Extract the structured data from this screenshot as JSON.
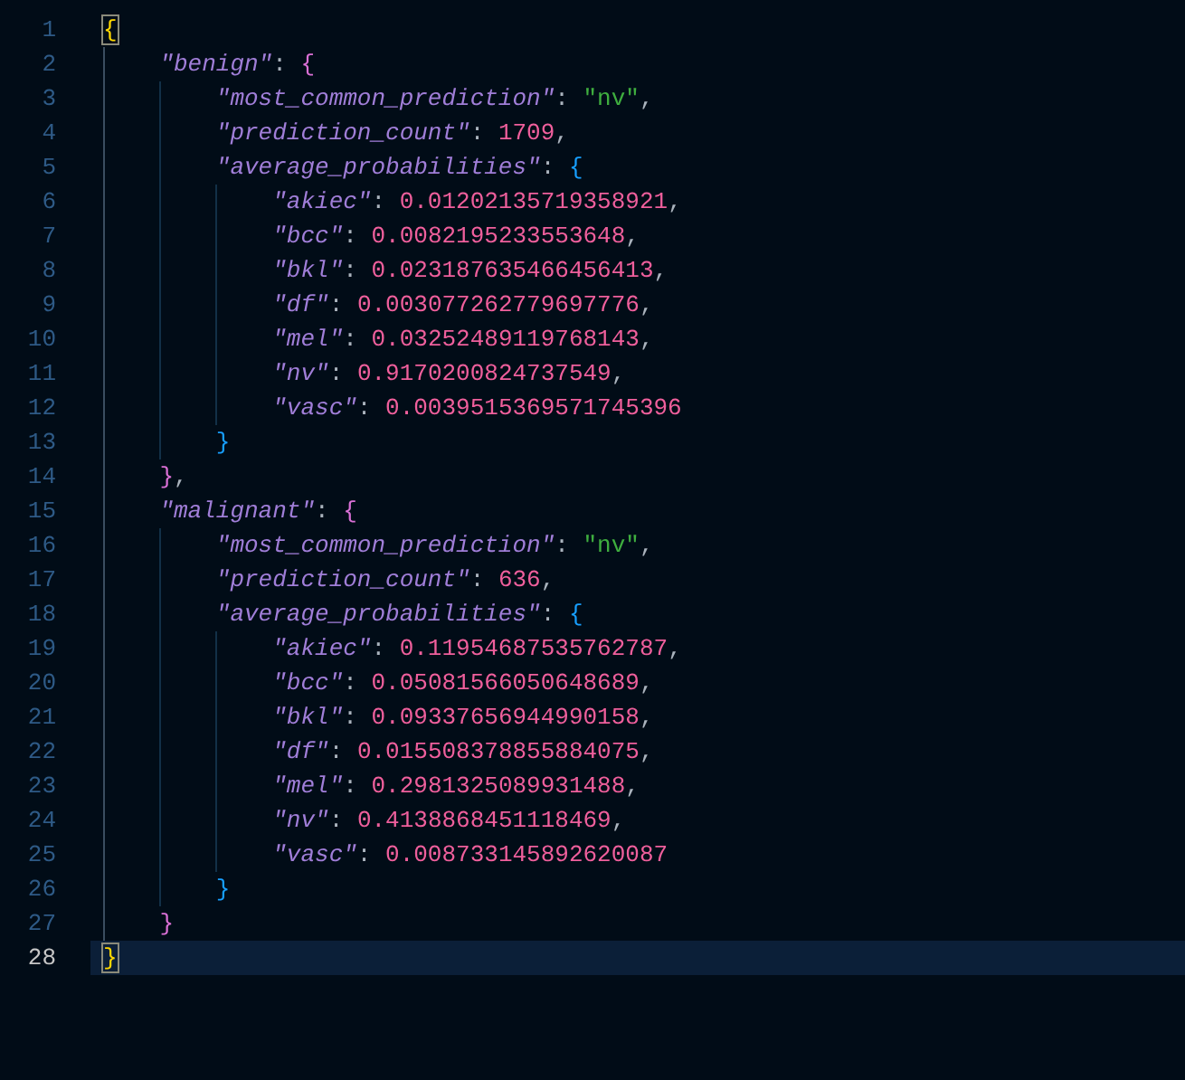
{
  "editor": {
    "lines": [
      {
        "number": "1",
        "current": false,
        "tokens": [
          {
            "kind": "open",
            "text": "{",
            "matched": true
          }
        ]
      },
      {
        "number": "2",
        "current": false,
        "tokens": [
          {
            "kind": "key",
            "text": "\"benign\""
          },
          {
            "kind": "colon",
            "text": ":"
          },
          {
            "kind": "open",
            "text": "{",
            "matched": false
          }
        ]
      },
      {
        "number": "3",
        "current": false,
        "tokens": [
          {
            "kind": "key",
            "text": "\"most_common_prediction\""
          },
          {
            "kind": "colon",
            "text": ":"
          },
          {
            "kind": "string",
            "text": "\"nv\""
          },
          {
            "kind": "comma",
            "text": ","
          }
        ]
      },
      {
        "number": "4",
        "current": false,
        "tokens": [
          {
            "kind": "key",
            "text": "\"prediction_count\""
          },
          {
            "kind": "colon",
            "text": ":"
          },
          {
            "kind": "number",
            "text": "1709"
          },
          {
            "kind": "comma",
            "text": ","
          }
        ]
      },
      {
        "number": "5",
        "current": false,
        "tokens": [
          {
            "kind": "key",
            "text": "\"average_probabilities\""
          },
          {
            "kind": "colon",
            "text": ":"
          },
          {
            "kind": "open",
            "text": "{",
            "matched": false
          }
        ]
      },
      {
        "number": "6",
        "current": false,
        "tokens": [
          {
            "kind": "key",
            "text": "\"akiec\""
          },
          {
            "kind": "colon",
            "text": ":"
          },
          {
            "kind": "number",
            "text": "0.01202135719358921"
          },
          {
            "kind": "comma",
            "text": ","
          }
        ]
      },
      {
        "number": "7",
        "current": false,
        "tokens": [
          {
            "kind": "key",
            "text": "\"bcc\""
          },
          {
            "kind": "colon",
            "text": ":"
          },
          {
            "kind": "number",
            "text": "0.0082195233553648"
          },
          {
            "kind": "comma",
            "text": ","
          }
        ]
      },
      {
        "number": "8",
        "current": false,
        "tokens": [
          {
            "kind": "key",
            "text": "\"bkl\""
          },
          {
            "kind": "colon",
            "text": ":"
          },
          {
            "kind": "number",
            "text": "0.023187635466456413"
          },
          {
            "kind": "comma",
            "text": ","
          }
        ]
      },
      {
        "number": "9",
        "current": false,
        "tokens": [
          {
            "kind": "key",
            "text": "\"df\""
          },
          {
            "kind": "colon",
            "text": ":"
          },
          {
            "kind": "number",
            "text": "0.003077262779697776"
          },
          {
            "kind": "comma",
            "text": ","
          }
        ]
      },
      {
        "number": "10",
        "current": false,
        "tokens": [
          {
            "kind": "key",
            "text": "\"mel\""
          },
          {
            "kind": "colon",
            "text": ":"
          },
          {
            "kind": "number",
            "text": "0.03252489119768143"
          },
          {
            "kind": "comma",
            "text": ","
          }
        ]
      },
      {
        "number": "11",
        "current": false,
        "tokens": [
          {
            "kind": "key",
            "text": "\"nv\""
          },
          {
            "kind": "colon",
            "text": ":"
          },
          {
            "kind": "number",
            "text": "0.9170200824737549"
          },
          {
            "kind": "comma",
            "text": ","
          }
        ]
      },
      {
        "number": "12",
        "current": false,
        "tokens": [
          {
            "kind": "key",
            "text": "\"vasc\""
          },
          {
            "kind": "colon",
            "text": ":"
          },
          {
            "kind": "number",
            "text": "0.0039515369571745396"
          }
        ]
      },
      {
        "number": "13",
        "current": false,
        "tokens": [
          {
            "kind": "close",
            "text": "}",
            "matched": false
          }
        ]
      },
      {
        "number": "14",
        "current": false,
        "tokens": [
          {
            "kind": "close",
            "text": "}",
            "matched": false
          },
          {
            "kind": "comma",
            "text": ","
          }
        ]
      },
      {
        "number": "15",
        "current": false,
        "tokens": [
          {
            "kind": "key",
            "text": "\"malignant\""
          },
          {
            "kind": "colon",
            "text": ":"
          },
          {
            "kind": "open",
            "text": "{",
            "matched": false
          }
        ]
      },
      {
        "number": "16",
        "current": false,
        "tokens": [
          {
            "kind": "key",
            "text": "\"most_common_prediction\""
          },
          {
            "kind": "colon",
            "text": ":"
          },
          {
            "kind": "string",
            "text": "\"nv\""
          },
          {
            "kind": "comma",
            "text": ","
          }
        ]
      },
      {
        "number": "17",
        "current": false,
        "tokens": [
          {
            "kind": "key",
            "text": "\"prediction_count\""
          },
          {
            "kind": "colon",
            "text": ":"
          },
          {
            "kind": "number",
            "text": "636"
          },
          {
            "kind": "comma",
            "text": ","
          }
        ]
      },
      {
        "number": "18",
        "current": false,
        "tokens": [
          {
            "kind": "key",
            "text": "\"average_probabilities\""
          },
          {
            "kind": "colon",
            "text": ":"
          },
          {
            "kind": "open",
            "text": "{",
            "matched": false
          }
        ]
      },
      {
        "number": "19",
        "current": false,
        "tokens": [
          {
            "kind": "key",
            "text": "\"akiec\""
          },
          {
            "kind": "colon",
            "text": ":"
          },
          {
            "kind": "number",
            "text": "0.11954687535762787"
          },
          {
            "kind": "comma",
            "text": ","
          }
        ]
      },
      {
        "number": "20",
        "current": false,
        "tokens": [
          {
            "kind": "key",
            "text": "\"bcc\""
          },
          {
            "kind": "colon",
            "text": ":"
          },
          {
            "kind": "number",
            "text": "0.05081566050648689"
          },
          {
            "kind": "comma",
            "text": ","
          }
        ]
      },
      {
        "number": "21",
        "current": false,
        "tokens": [
          {
            "kind": "key",
            "text": "\"bkl\""
          },
          {
            "kind": "colon",
            "text": ":"
          },
          {
            "kind": "number",
            "text": "0.09337656944990158"
          },
          {
            "kind": "comma",
            "text": ","
          }
        ]
      },
      {
        "number": "22",
        "current": false,
        "tokens": [
          {
            "kind": "key",
            "text": "\"df\""
          },
          {
            "kind": "colon",
            "text": ":"
          },
          {
            "kind": "number",
            "text": "0.015508378855884075"
          },
          {
            "kind": "comma",
            "text": ","
          }
        ]
      },
      {
        "number": "23",
        "current": false,
        "tokens": [
          {
            "kind": "key",
            "text": "\"mel\""
          },
          {
            "kind": "colon",
            "text": ":"
          },
          {
            "kind": "number",
            "text": "0.2981325089931488"
          },
          {
            "kind": "comma",
            "text": ","
          }
        ]
      },
      {
        "number": "24",
        "current": false,
        "tokens": [
          {
            "kind": "key",
            "text": "\"nv\""
          },
          {
            "kind": "colon",
            "text": ":"
          },
          {
            "kind": "number",
            "text": "0.4138868451118469"
          },
          {
            "kind": "comma",
            "text": ","
          }
        ]
      },
      {
        "number": "25",
        "current": false,
        "tokens": [
          {
            "kind": "key",
            "text": "\"vasc\""
          },
          {
            "kind": "colon",
            "text": ":"
          },
          {
            "kind": "number",
            "text": "0.008733145892620087"
          }
        ]
      },
      {
        "number": "26",
        "current": false,
        "tokens": [
          {
            "kind": "close",
            "text": "}",
            "matched": false
          }
        ]
      },
      {
        "number": "27",
        "current": false,
        "tokens": [
          {
            "kind": "close",
            "text": "}",
            "matched": false
          }
        ]
      },
      {
        "number": "28",
        "current": true,
        "tokens": [
          {
            "kind": "close",
            "text": "}",
            "matched": true
          }
        ]
      }
    ]
  }
}
